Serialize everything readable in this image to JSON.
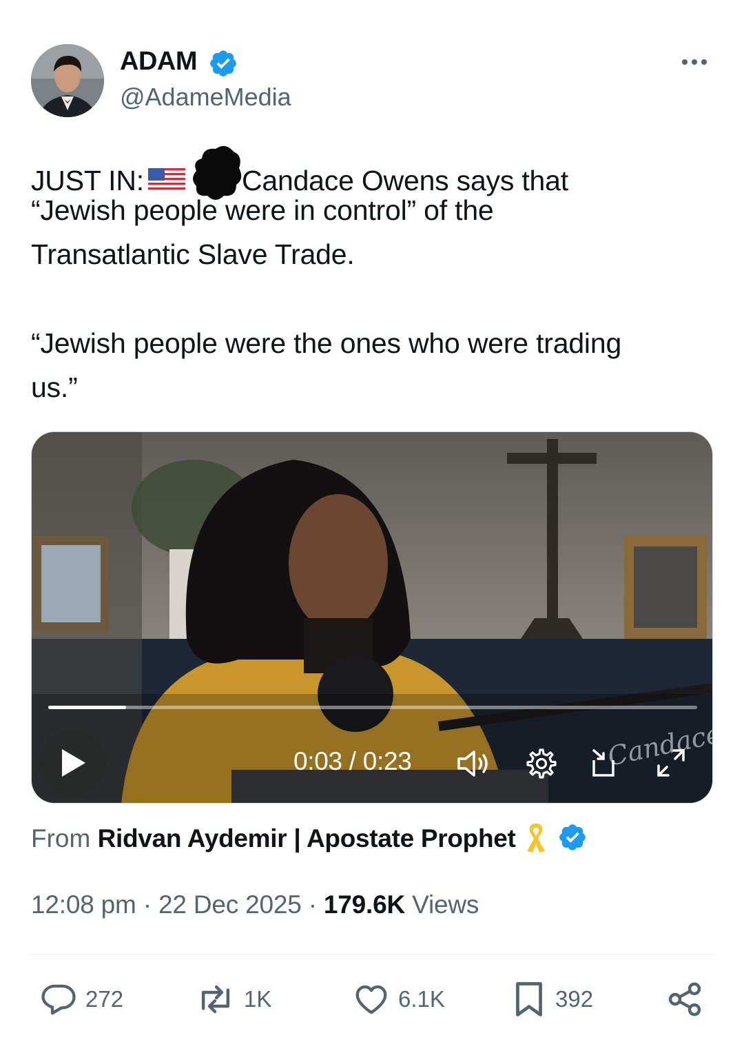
{
  "author": {
    "name": "ADAM",
    "handle": "@AdameMedia",
    "verified": true
  },
  "tweet": {
    "lines": [
      "JUST IN:",
      "Candace Owens says that",
      "“Jewish people were in control” of the",
      "Transatlantic Slave Trade.",
      "“Jewish people were the ones who were trading",
      "us.”"
    ],
    "flag_icon": "us-flag-emoji"
  },
  "video": {
    "time": "0:03 / 0:23",
    "progress": 0.12,
    "watermark": "Candace"
  },
  "source": {
    "prefix": "From",
    "name": "Ridvan Aydemir | Apostate Prophet",
    "ribbon_icon": "yellow-ribbon-emoji",
    "verified": true
  },
  "meta": {
    "time": "12:08 pm",
    "sep1": "·",
    "date": "22 Dec 2025",
    "sep2": "·",
    "views_count": "179.6K",
    "views_label": "Views"
  },
  "actions": {
    "replies": "272",
    "reposts": "1K",
    "likes": "6.1K",
    "bookmarks": "392"
  },
  "colors": {
    "verified": "#1d9bf0",
    "secondary_text": "#536471",
    "primary_text": "#0f1419"
  }
}
